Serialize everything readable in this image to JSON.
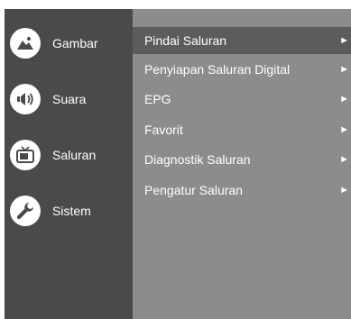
{
  "sidebar": {
    "items": [
      {
        "label": "Gambar",
        "icon": "picture-icon"
      },
      {
        "label": "Suara",
        "icon": "speaker-icon"
      },
      {
        "label": "Saluran",
        "icon": "tv-icon"
      },
      {
        "label": "Sistem",
        "icon": "wrench-icon"
      }
    ]
  },
  "menu": {
    "items": [
      {
        "label": "Pindai Saluran",
        "arrow": "►",
        "selected": true
      },
      {
        "label": "Penyiapan Saluran Digital",
        "arrow": "►"
      },
      {
        "label": "EPG",
        "arrow": "►"
      },
      {
        "label": "Favorit",
        "arrow": "►"
      },
      {
        "label": "Diagnostik Saluran",
        "arrow": "►"
      },
      {
        "label": "Pengatur Saluran",
        "arrow": "►"
      }
    ]
  },
  "colors": {
    "sidebar_bg": "#4a4a4a",
    "content_bg": "#8c8c8c",
    "selected_bg": "#5c5c5c",
    "text": "#ffffff"
  }
}
